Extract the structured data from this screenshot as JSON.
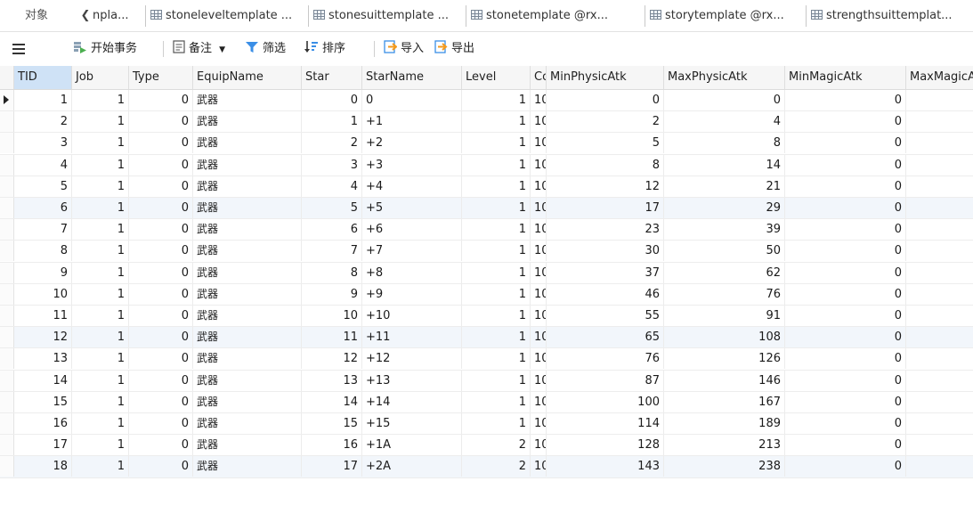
{
  "tabs": {
    "objects_label": "对象",
    "items": [
      "nplа...",
      "stoneleveltemplate ...",
      "stonesuittemplate ...",
      "stonetemplate @rx...",
      "storytemplate @rx...",
      "strengthsuittemplat..."
    ]
  },
  "toolbar": {
    "begin_transaction": "开始事务",
    "memo": "备注",
    "filter": "筛选",
    "sort": "排序",
    "import": "导入",
    "export": "导出"
  },
  "grid": {
    "columns": [
      "TID",
      "Job",
      "Type",
      "EquipName",
      "Star",
      "StarName",
      "Level",
      "Cost",
      "MinPhysicAtk",
      "MaxPhysicAtk",
      "MinMagicAtk",
      "MaxMagicAtk"
    ],
    "selected_column": "TID",
    "current_row": 1,
    "rows": [
      {
        "TID": "1",
        "Job": "1",
        "Type": "0",
        "EquipName": "武器",
        "Star": "0",
        "StarName": "0",
        "Level": "1",
        "Cost": "10",
        "MinPhysicAtk": "0",
        "MaxPhysicAtk": "0",
        "MinMagicAtk": "0"
      },
      {
        "TID": "2",
        "Job": "1",
        "Type": "0",
        "EquipName": "武器",
        "Star": "1",
        "StarName": "+1",
        "Level": "1",
        "Cost": "10",
        "MinPhysicAtk": "2",
        "MaxPhysicAtk": "4",
        "MinMagicAtk": "0"
      },
      {
        "TID": "3",
        "Job": "1",
        "Type": "0",
        "EquipName": "武器",
        "Star": "2",
        "StarName": "+2",
        "Level": "1",
        "Cost": "10",
        "MinPhysicAtk": "5",
        "MaxPhysicAtk": "8",
        "MinMagicAtk": "0"
      },
      {
        "TID": "4",
        "Job": "1",
        "Type": "0",
        "EquipName": "武器",
        "Star": "3",
        "StarName": "+3",
        "Level": "1",
        "Cost": "10",
        "MinPhysicAtk": "8",
        "MaxPhysicAtk": "14",
        "MinMagicAtk": "0"
      },
      {
        "TID": "5",
        "Job": "1",
        "Type": "0",
        "EquipName": "武器",
        "Star": "4",
        "StarName": "+4",
        "Level": "1",
        "Cost": "10",
        "MinPhysicAtk": "12",
        "MaxPhysicAtk": "21",
        "MinMagicAtk": "0"
      },
      {
        "TID": "6",
        "Job": "1",
        "Type": "0",
        "EquipName": "武器",
        "Star": "5",
        "StarName": "+5",
        "Level": "1",
        "Cost": "10",
        "MinPhysicAtk": "17",
        "MaxPhysicAtk": "29",
        "MinMagicAtk": "0"
      },
      {
        "TID": "7",
        "Job": "1",
        "Type": "0",
        "EquipName": "武器",
        "Star": "6",
        "StarName": "+6",
        "Level": "1",
        "Cost": "10",
        "MinPhysicAtk": "23",
        "MaxPhysicAtk": "39",
        "MinMagicAtk": "0"
      },
      {
        "TID": "8",
        "Job": "1",
        "Type": "0",
        "EquipName": "武器",
        "Star": "7",
        "StarName": "+7",
        "Level": "1",
        "Cost": "10",
        "MinPhysicAtk": "30",
        "MaxPhysicAtk": "50",
        "MinMagicAtk": "0"
      },
      {
        "TID": "9",
        "Job": "1",
        "Type": "0",
        "EquipName": "武器",
        "Star": "8",
        "StarName": "+8",
        "Level": "1",
        "Cost": "10",
        "MinPhysicAtk": "37",
        "MaxPhysicAtk": "62",
        "MinMagicAtk": "0"
      },
      {
        "TID": "10",
        "Job": "1",
        "Type": "0",
        "EquipName": "武器",
        "Star": "9",
        "StarName": "+9",
        "Level": "1",
        "Cost": "10",
        "MinPhysicAtk": "46",
        "MaxPhysicAtk": "76",
        "MinMagicAtk": "0"
      },
      {
        "TID": "11",
        "Job": "1",
        "Type": "0",
        "EquipName": "武器",
        "Star": "10",
        "StarName": "+10",
        "Level": "1",
        "Cost": "10",
        "MinPhysicAtk": "55",
        "MaxPhysicAtk": "91",
        "MinMagicAtk": "0"
      },
      {
        "TID": "12",
        "Job": "1",
        "Type": "0",
        "EquipName": "武器",
        "Star": "11",
        "StarName": "+11",
        "Level": "1",
        "Cost": "10",
        "MinPhysicAtk": "65",
        "MaxPhysicAtk": "108",
        "MinMagicAtk": "0"
      },
      {
        "TID": "13",
        "Job": "1",
        "Type": "0",
        "EquipName": "武器",
        "Star": "12",
        "StarName": "+12",
        "Level": "1",
        "Cost": "10",
        "MinPhysicAtk": "76",
        "MaxPhysicAtk": "126",
        "MinMagicAtk": "0"
      },
      {
        "TID": "14",
        "Job": "1",
        "Type": "0",
        "EquipName": "武器",
        "Star": "13",
        "StarName": "+13",
        "Level": "1",
        "Cost": "10",
        "MinPhysicAtk": "87",
        "MaxPhysicAtk": "146",
        "MinMagicAtk": "0"
      },
      {
        "TID": "15",
        "Job": "1",
        "Type": "0",
        "EquipName": "武器",
        "Star": "14",
        "StarName": "+14",
        "Level": "1",
        "Cost": "10",
        "MinPhysicAtk": "100",
        "MaxPhysicAtk": "167",
        "MinMagicAtk": "0"
      },
      {
        "TID": "16",
        "Job": "1",
        "Type": "0",
        "EquipName": "武器",
        "Star": "15",
        "StarName": "+15",
        "Level": "1",
        "Cost": "10",
        "MinPhysicAtk": "114",
        "MaxPhysicAtk": "189",
        "MinMagicAtk": "0"
      },
      {
        "TID": "17",
        "Job": "1",
        "Type": "0",
        "EquipName": "武器",
        "Star": "16",
        "StarName": "+1A",
        "Level": "2",
        "Cost": "10",
        "MinPhysicAtk": "128",
        "MaxPhysicAtk": "213",
        "MinMagicAtk": "0"
      },
      {
        "TID": "18",
        "Job": "1",
        "Type": "0",
        "EquipName": "武器",
        "Star": "17",
        "StarName": "+2A",
        "Level": "2",
        "Cost": "10",
        "MinPhysicAtk": "143",
        "MaxPhysicAtk": "238",
        "MinMagicAtk": "0"
      }
    ]
  },
  "icon_names": {
    "menu": "hamburger-menu-icon",
    "begin_transaction": "transaction-play-icon",
    "memo": "memo-note-icon",
    "filter": "filter-funnel-icon",
    "sort": "sort-icon",
    "import": "import-icon",
    "export": "export-icon",
    "table": "table-icon",
    "row_marker": "current-row-arrow-icon"
  },
  "colors": {
    "accent": "#3a8ee6",
    "header_selected": "#cfe2f6",
    "row_alt": "#f2f6fb",
    "import_icon": "#f39a1d",
    "filter_icon": "#3a8ee6",
    "transaction_icon": "#4caf50"
  }
}
